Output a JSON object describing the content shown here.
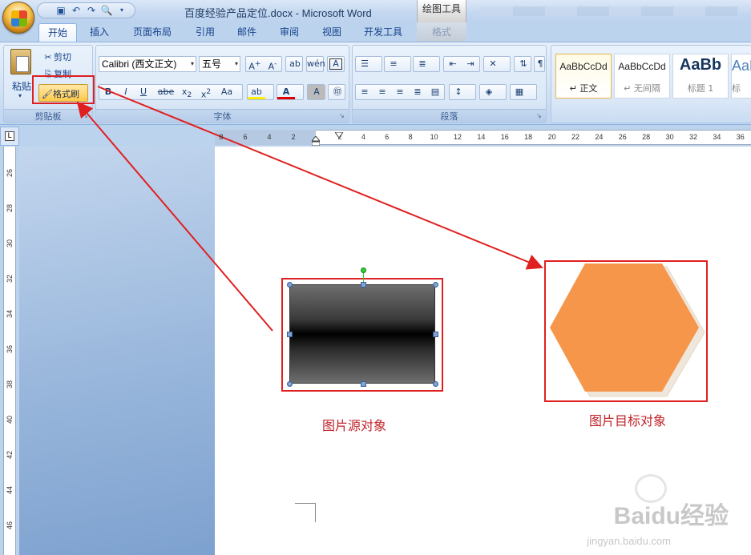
{
  "window": {
    "title": "百度经验产品定位.docx - Microsoft Word",
    "context_tool": "绘图工具"
  },
  "tabs": [
    {
      "label": "开始",
      "active": true
    },
    {
      "label": "插入"
    },
    {
      "label": "页面布局"
    },
    {
      "label": "引用"
    },
    {
      "label": "邮件"
    },
    {
      "label": "审阅"
    },
    {
      "label": "视图"
    },
    {
      "label": "开发工具"
    },
    {
      "label": "格式"
    }
  ],
  "clipboard": {
    "paste_label": "粘贴",
    "cut_label": "剪切",
    "copy_label": "复制",
    "format_painter_label": "格式刷",
    "group_label": "剪贴板"
  },
  "font": {
    "font_name": "Calibri (西文正文)",
    "font_size": "五号",
    "group_label": "字体"
  },
  "paragraph": {
    "group_label": "段落"
  },
  "styles": [
    {
      "sample": "AaBbCcDd",
      "name": "↵ 正文"
    },
    {
      "sample": "AaBbCcDd",
      "name": "↵ 无间隔"
    },
    {
      "sample": "AaBb",
      "name": "标题 1"
    },
    {
      "sample": "AaB",
      "name": "标"
    }
  ],
  "ruler": {
    "h_left": [
      "8",
      "6",
      "4",
      "2"
    ],
    "h_right": [
      "2",
      "4",
      "6",
      "8",
      "10",
      "12",
      "14",
      "16",
      "18",
      "20",
      "22",
      "24",
      "26",
      "28",
      "30",
      "32",
      "34",
      "36"
    ],
    "v": [
      "26",
      "28",
      "30",
      "32",
      "34",
      "36",
      "38",
      "40",
      "42",
      "44",
      "46"
    ]
  },
  "document": {
    "source_caption": "图片源对象",
    "target_caption": "图片目标对象",
    "hexagon_color": "#f5964a",
    "accent_red": "#e02020"
  },
  "watermark": {
    "brand": "Baidu经验",
    "url": "jingyan.baidu.com"
  }
}
